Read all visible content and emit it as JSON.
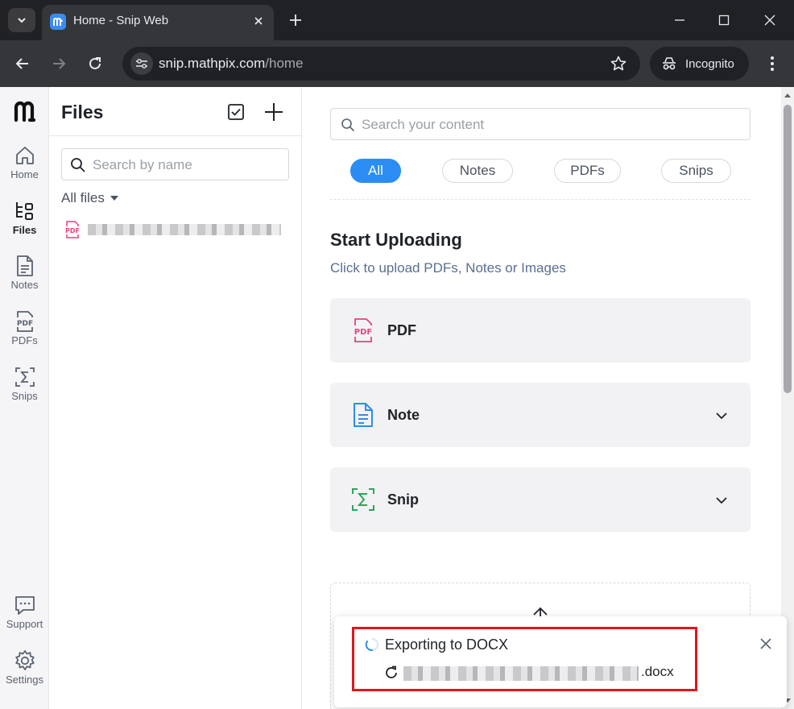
{
  "browser": {
    "tab_title": "Home - Snip Web",
    "url_host": "snip.mathpix.com",
    "url_path": "/home",
    "incognito_label": "Incognito"
  },
  "rail": {
    "items": [
      {
        "label": "Home",
        "icon": "home-icon"
      },
      {
        "label": "Files",
        "icon": "files-icon",
        "active": true
      },
      {
        "label": "Notes",
        "icon": "notes-icon"
      },
      {
        "label": "PDFs",
        "icon": "pdfs-icon"
      },
      {
        "label": "Snips",
        "icon": "snips-icon"
      }
    ],
    "bottom": [
      {
        "label": "Support",
        "icon": "support-icon"
      },
      {
        "label": "Settings",
        "icon": "settings-icon"
      }
    ]
  },
  "files_panel": {
    "title": "Files",
    "search_placeholder": "Search by name",
    "filter_label": "All files"
  },
  "main": {
    "search_placeholder": "Search your content",
    "filters": [
      "All",
      "Notes",
      "PDFs",
      "Snips"
    ],
    "active_filter": "All",
    "section_title": "Start Uploading",
    "section_subtitle": "Click to upload PDFs, Notes or Images",
    "upload_cards": [
      {
        "label": "PDF",
        "icon": "pdf-icon",
        "expandable": false
      },
      {
        "label": "Note",
        "icon": "note-icon",
        "expandable": true
      },
      {
        "label": "Snip",
        "icon": "snip-icon",
        "expandable": true
      }
    ]
  },
  "toast": {
    "title": "Exporting to DOCX",
    "file_extension": ".docx"
  },
  "colors": {
    "accent": "#2b8df3",
    "pdf_red": "#e0467c",
    "note_blue": "#2b8df3",
    "snip_green": "#2fa45a",
    "highlight_red": "#e0161b"
  }
}
